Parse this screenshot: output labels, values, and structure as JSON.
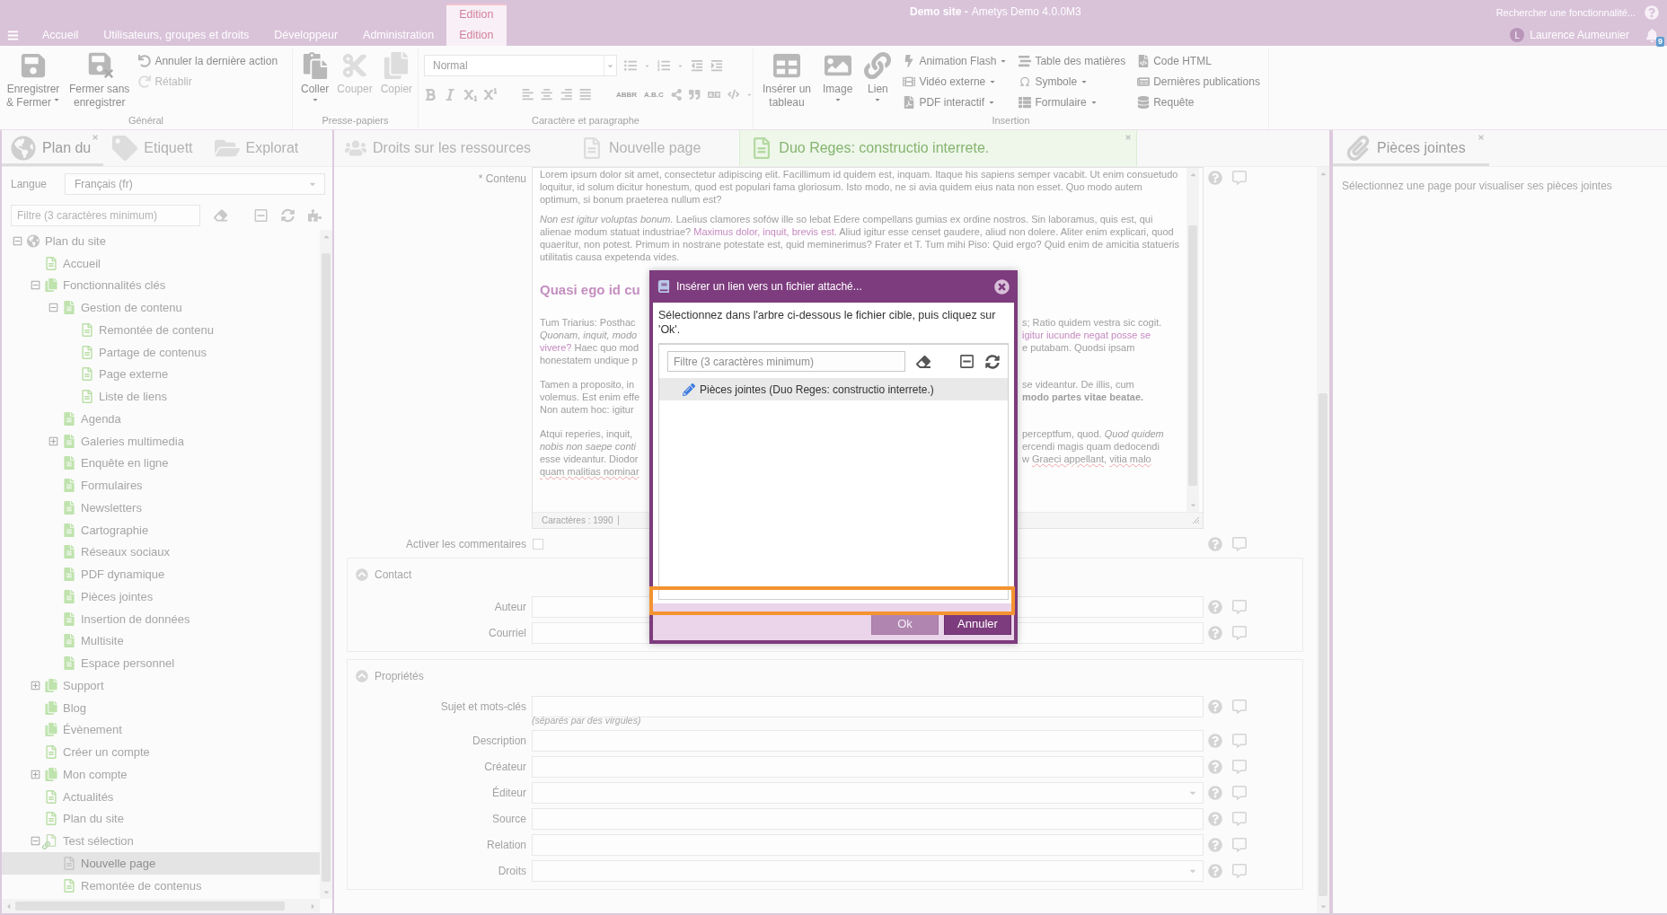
{
  "header": {
    "tabs": [
      {
        "label": "Accueil",
        "selected": false
      },
      {
        "label": "Utilisateurs, groupes et droits",
        "selected": false
      },
      {
        "label": "Développeur",
        "selected": false
      },
      {
        "label": "Administration",
        "selected": false
      },
      {
        "label": "Edition",
        "context": "Edition",
        "selected": true
      }
    ],
    "site_name": "Demo site -",
    "app_name": "Ametys Demo 4.0.0M3",
    "search": {
      "placeholder": "Rechercher une fonctionnalité..."
    },
    "user": {
      "initial": "L",
      "name": "Laurence Aumeunier"
    },
    "notification_count": "9"
  },
  "ribbon": {
    "groups": [
      {
        "kind": "buttons",
        "label": "Général",
        "large": [
          {
            "lines": [
              "Enregistrer",
              "& Fermer"
            ],
            "dropdown": true,
            "disabled": false
          },
          {
            "lines": [
              "Fermer sans",
              "enregistrer"
            ],
            "dropdown": false,
            "disabled": false
          }
        ],
        "small": [
          {
            "label": "Annuler la dernière action",
            "dropdown": false,
            "disabled": false
          },
          {
            "label": "Rétablir",
            "dropdown": false,
            "disabled": true
          }
        ]
      },
      {
        "kind": "buttons",
        "label": "Presse-papiers",
        "large": [
          {
            "lines": [
              "Coller"
            ],
            "dropdown": true,
            "disabled": false
          },
          {
            "lines": [
              "Couper"
            ],
            "dropdown": false,
            "disabled": true
          },
          {
            "lines": [
              "Copier"
            ],
            "dropdown": false,
            "disabled": true
          }
        ]
      },
      {
        "kind": "formatting",
        "label": "Caractère et paragraphe",
        "style_select": {
          "value": "Normal"
        },
        "text_tools": [
          "ABBR",
          "A.B.C"
        ]
      },
      {
        "kind": "buttons",
        "label": "Insertion",
        "large": [
          {
            "lines": [
              "Insérer un",
              "tableau"
            ],
            "dropdown": false,
            "disabled": false
          },
          {
            "lines": [
              "Image"
            ],
            "dropdown": true,
            "disabled": false
          },
          {
            "lines": [
              "Lien"
            ],
            "dropdown": true,
            "disabled": false
          }
        ],
        "small": [
          {
            "label": "Animation Flash",
            "dropdown": true,
            "disabled": false
          },
          {
            "label": "Vidéo externe",
            "dropdown": true,
            "disabled": false
          },
          {
            "label": "PDF interactif",
            "dropdown": true,
            "disabled": false
          },
          {
            "label": "Table des matières",
            "dropdown": false,
            "disabled": false
          },
          {
            "label": "Symbole",
            "dropdown": true,
            "disabled": false
          },
          {
            "label": "Formulaire",
            "dropdown": true,
            "disabled": false
          },
          {
            "label": "Code HTML",
            "dropdown": false,
            "disabled": false
          },
          {
            "label": "Dernières publications",
            "dropdown": false,
            "disabled": false
          },
          {
            "label": "Requête",
            "dropdown": false,
            "disabled": false
          }
        ]
      }
    ]
  },
  "left_panel": {
    "tabs": [
      {
        "label": "Plan du",
        "selected": true,
        "closable": true
      },
      {
        "label": "Etiquett",
        "selected": false,
        "closable": false
      },
      {
        "label": "Explorat",
        "selected": false,
        "closable": false
      }
    ],
    "language": {
      "label": "Langue",
      "value": "Français (fr)"
    },
    "filter": {
      "placeholder": "Filtre (3 caractères minimum)"
    },
    "tree": [
      {
        "label": "Plan du site",
        "kind": "site",
        "selected": false,
        "expanded": true,
        "children": [
          {
            "label": "Accueil",
            "kind": "page",
            "selected": false
          },
          {
            "label": "Fonctionnalités clés",
            "kind": "section",
            "selected": false,
            "expanded": true,
            "children": [
              {
                "label": "Gestion de contenu",
                "kind": "content",
                "selected": false,
                "expanded": true,
                "children": [
                  {
                    "label": "Remontée de contenu",
                    "kind": "page",
                    "selected": false
                  },
                  {
                    "label": "Partage de contenus",
                    "kind": "page",
                    "selected": false
                  },
                  {
                    "label": "Page externe",
                    "kind": "page",
                    "selected": false
                  },
                  {
                    "label": "Liste de liens",
                    "kind": "page",
                    "selected": false
                  }
                ]
              },
              {
                "label": "Agenda",
                "kind": "content",
                "selected": false
              },
              {
                "label": "Galeries multimedia",
                "kind": "content",
                "selected": false,
                "expanded": false
              },
              {
                "label": "Enquête en ligne",
                "kind": "content",
                "selected": false
              },
              {
                "label": "Formulaires",
                "kind": "content",
                "selected": false
              },
              {
                "label": "Newsletters",
                "kind": "content",
                "selected": false
              },
              {
                "label": "Cartographie",
                "kind": "content",
                "selected": false
              },
              {
                "label": "Réseaux sociaux",
                "kind": "content",
                "selected": false
              },
              {
                "label": "PDF dynamique",
                "kind": "content",
                "selected": false
              },
              {
                "label": "Pièces jointes",
                "kind": "content",
                "selected": false
              },
              {
                "label": "Insertion de données",
                "kind": "content",
                "selected": false
              },
              {
                "label": "Multisite",
                "kind": "content",
                "selected": false
              },
              {
                "label": "Espace personnel",
                "kind": "content",
                "selected": false
              }
            ]
          },
          {
            "label": "Support",
            "kind": "section",
            "selected": false,
            "expanded": false
          },
          {
            "label": "Blog",
            "kind": "section",
            "selected": false
          },
          {
            "label": "Évènement",
            "kind": "section",
            "selected": false
          },
          {
            "label": "Créer un compte",
            "kind": "page",
            "selected": false
          },
          {
            "label": "Mon compte",
            "kind": "section",
            "selected": false,
            "expanded": false
          },
          {
            "label": "Actualités",
            "kind": "page",
            "selected": false
          },
          {
            "label": "Plan du site",
            "kind": "page",
            "selected": false
          },
          {
            "label": "Test sélection",
            "kind": "link",
            "selected": false,
            "expanded": true,
            "children": [
              {
                "label": "Nouvelle page",
                "kind": "blank",
                "selected": true
              },
              {
                "label": "Remontée de contenus",
                "kind": "page",
                "selected": false
              }
            ]
          }
        ]
      }
    ]
  },
  "center_panel": {
    "tabs": [
      {
        "label": "Droits sur les ressources",
        "selected": false,
        "closable": false
      },
      {
        "label": "Nouvelle page",
        "selected": false,
        "closable": false
      },
      {
        "label": "Duo Reges: constructio interrete.",
        "selected": true,
        "closable": true
      }
    ],
    "content": {
      "label": "* Contenu",
      "paragraphs": [
        [
          {
            "text": "Lorem ipsum dolor sit amet, consectetur adipiscing elit. Facillimum id quidem est, inquam. Itaque his sapiens semper vacabit. Ut enim consuetudo loquitur, id solum dicitur honestum, quod est populari fama gloriosum. Isto modo, ne si avia quidem eius nata non esset. Quo modo autem optimum, si bonum praeterea nullum est?",
            "kind": "plain"
          }
        ],
        [
          {
            "text": "Non est igitur voluptas bonum.",
            "kind": "italic"
          },
          {
            "text": " Laelius clamores sofów ille so lebat Edere compellans gumias ex ordine nostros. Sin laboramus, quis est, qui alienae modum statuat industriae? ",
            "kind": "plain"
          },
          {
            "text": "Maximus dolor, inquit, brevis est.",
            "kind": "link"
          },
          {
            "text": " Aliud igitur esse censet gaudere, aliud non dolere. Aliter enim explicari, quod quaeritur, non potest. Primum in nostrane potestate est, quid meminerimus? Frater et T. Tum mihi Piso: Quid ergo? Quid enim de amicitia statueris utilitatis causa expetenda vides.",
            "kind": "plain"
          }
        ]
      ],
      "heading": "Quasi ego id cu",
      "split_paragraphs": [
        [
          {
            "left": [
              {
                "text": "Tum Triarius: Posthac",
                "kind": "plain"
              }
            ],
            "right": [
              {
                "text": "s; Ratio quidem vestra sic cogit.",
                "kind": "plain"
              }
            ]
          },
          {
            "left": [
              {
                "text": "Quonam, inquit, modo",
                "kind": "italic"
              }
            ],
            "right": [
              {
                "text": "igitur iucunde negat posse se",
                "kind": "link"
              }
            ]
          },
          {
            "left": [
              {
                "text": "vivere?",
                "kind": "link"
              },
              {
                "text": " Haec quo mod",
                "kind": "plain"
              }
            ],
            "right": [
              {
                "text": "e putabam. Quodsi ipsam",
                "kind": "plain"
              }
            ]
          },
          {
            "left": [
              {
                "text": "honestatem undique p",
                "kind": "plain"
              }
            ]
          }
        ],
        [
          {
            "left": [
              {
                "text": "Tamen a proposito, in",
                "kind": "plain"
              }
            ],
            "right": [
              {
                "text": "se videantur. De illis, cum",
                "kind": "plain"
              }
            ]
          },
          {
            "left": [
              {
                "text": "volemus. Est enim effe",
                "kind": "plain"
              }
            ],
            "right": [
              {
                "text": "modo partes vitae beatae.",
                "kind": "bold"
              }
            ]
          },
          {
            "left": [
              {
                "text": "Non autem hoc: igitur",
                "kind": "plain"
              }
            ]
          }
        ],
        [
          {
            "left": [
              {
                "text": "Atqui reperies, inquit,",
                "kind": "plain"
              }
            ],
            "right": [
              {
                "text": "perceptfum, quod. ",
                "kind": "plain"
              },
              {
                "text": "Quod quidem",
                "kind": "italic"
              }
            ]
          },
          {
            "left": [
              {
                "text": "nobis non saepe conti",
                "kind": "italic"
              }
            ],
            "right": [
              {
                "text": "ercendi magis quam dedocendi",
                "kind": "plain"
              }
            ]
          },
          {
            "left": [
              {
                "text": "esse videantur. Diodor",
                "kind": "plain"
              }
            ],
            "right": [
              {
                "text": "w ",
                "kind": "plain"
              },
              {
                "text": "Graeci appellant",
                "kind": "misspelled"
              },
              {
                "text": ", ",
                "kind": "plain"
              },
              {
                "text": "vitia malo",
                "kind": "misspelled"
              }
            ]
          },
          {
            "left": [
              {
                "text": "quam malitias nominar",
                "kind": "misspelled"
              }
            ]
          }
        ]
      ],
      "char_count": "Caractères : 1990"
    },
    "comments": {
      "label": "Activer les commentaires",
      "checked": false
    },
    "sections": [
      {
        "title": "Contact",
        "expanded": true,
        "fields": [
          {
            "label": "Auteur",
            "kind": "text"
          },
          {
            "label": "Courriel",
            "kind": "text"
          }
        ]
      },
      {
        "title": "Propriétés",
        "expanded": true,
        "fields": [
          {
            "label": "Sujet et mots-clés",
            "kind": "text",
            "hint": "(séparés par des virgules)"
          },
          {
            "label": "Description",
            "kind": "text"
          },
          {
            "label": "Créateur",
            "kind": "text"
          },
          {
            "label": "Éditeur",
            "kind": "combo"
          },
          {
            "label": "Source",
            "kind": "text"
          },
          {
            "label": "Relation",
            "kind": "text"
          },
          {
            "label": "Droits",
            "kind": "combo"
          }
        ]
      }
    ]
  },
  "right_panel": {
    "tabs": [
      {
        "label": "Pièces jointes",
        "selected": true,
        "closable": true
      }
    ],
    "message": "Sélectionnez une page pour visualiser ses pièces jointes"
  },
  "dialog": {
    "title": "Insérer un lien vers un fichier attaché...",
    "instruction": "Sélectionnez dans l'arbre ci-dessous le fichier cible, puis cliquez sur 'Ok'.",
    "filter": {
      "placeholder": "Filtre (3 caractères minimum)"
    },
    "tree": [
      {
        "label": "Pièces jointes (Duo Reges: constructio interrete.)",
        "selected": true
      }
    ],
    "buttons": [
      {
        "label": "Ok",
        "disabled": true
      },
      {
        "label": "Annuler",
        "disabled": false
      }
    ]
  }
}
